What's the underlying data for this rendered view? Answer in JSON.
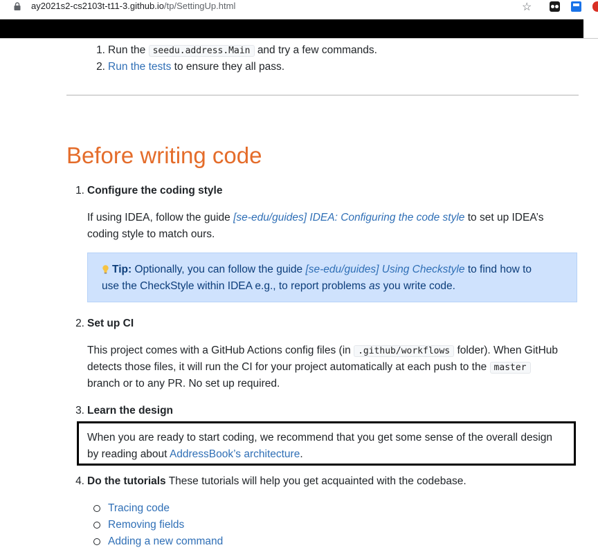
{
  "browser": {
    "url_domain": "ay2021s2-cs2103t-t11-3.github.io",
    "url_path": "/tp/SettingUp.html"
  },
  "top_list": {
    "item1_num": "1.",
    "item1_pre": "Run the",
    "item1_code": "seedu.address.Main",
    "item1_post": "and try a few commands.",
    "item2_num": "2.",
    "item2_link": "Run the tests",
    "item2_post": "to ensure they all pass."
  },
  "section": {
    "heading": "Before writing code",
    "step1": {
      "num": "1.",
      "title": "Configure the coding style",
      "p_pre": "If using IDEA, follow the guide",
      "p_link": "[se-edu/guides] IDEA: Configuring the code style",
      "p_post": "to set up IDEA’s",
      "p_line2": "coding style to match ours.",
      "tip_label": "Tip:",
      "tip_pre": "Optionally, you can follow the guide",
      "tip_link": "[se-edu/guides] Using Checkstyle",
      "tip_post": "to find how to",
      "tip_line2_pre": "use the CheckStyle within IDEA e.g., to report problems",
      "tip_line2_em": "as",
      "tip_line2_post": "you write code."
    },
    "step2": {
      "num": "2.",
      "title": "Set up CI",
      "l1_pre": "This project comes with a GitHub Actions config files (in",
      "l1_code": ".github/workflows",
      "l1_post": "folder). When GitHub",
      "l2_pre": "detects those files, it will run the CI for your project automatically at each push to the",
      "l2_code": "master",
      "l3": "branch or to any PR. No set up required."
    },
    "step3": {
      "num": "3.",
      "title": "Learn the design",
      "l1": "When you are ready to start coding, we recommend that you get some sense of the overall design",
      "l2_pre": "by reading about",
      "l2_link": "AddressBook’s architecture",
      "l2_post": "."
    },
    "step4": {
      "num": "4.",
      "title": "Do the tutorials",
      "desc": "These tutorials will help you get acquainted with the codebase.",
      "tutorials": [
        "Tracing code",
        "Removing fields",
        "Adding a new command"
      ]
    }
  }
}
